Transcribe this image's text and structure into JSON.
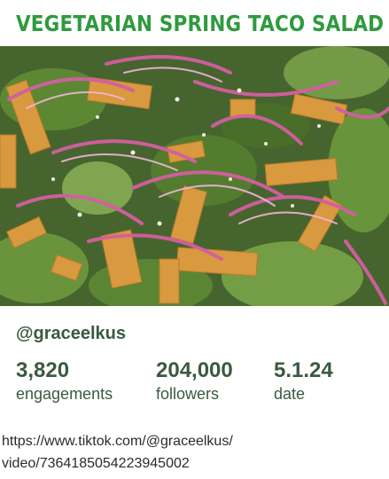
{
  "header": {
    "title": "VEGETARIAN SPRING TACO SALAD"
  },
  "image": {
    "icon": "salad-photo"
  },
  "author": {
    "handle": "@graceelkus"
  },
  "stats": [
    {
      "value": "3,820",
      "label": "engagements"
    },
    {
      "value": "204,000",
      "label": "followers"
    },
    {
      "value": "5.1.24",
      "label": "date"
    }
  ],
  "link": {
    "line1": "https://www.tiktok.com/@graceelkus/",
    "line2": "video/7364185054223945002"
  },
  "colors": {
    "title": "#2f9a3f",
    "text": "#3a5a40"
  }
}
